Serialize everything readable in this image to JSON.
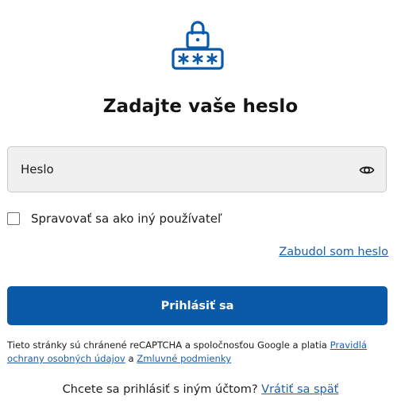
{
  "header": {
    "icon": "password-lock-icon",
    "title": "Zadajte vaše heslo"
  },
  "password_field": {
    "placeholder": "Heslo",
    "value": "",
    "toggle_icon": "eye-icon"
  },
  "impersonate": {
    "label": "Spravovať sa ako iný používateľ",
    "checked": false
  },
  "forgot_password": {
    "label": "Zabudol som heslo"
  },
  "login_button": {
    "label": "Prihlásiť sa"
  },
  "recaptcha": {
    "text_before": "Tieto stránky sú chránené reCAPTCHA a spoločnosťou Google a platia",
    "privacy_link": "Pravidlá ochrany osobných údajov",
    "conjunction": "a",
    "terms_link": "Zmluvné podmienky"
  },
  "switch_account": {
    "question": "Chcete sa prihlásiť s iným účtom?",
    "link": "Vrátiť sa späť"
  },
  "colors": {
    "primary": "#0a5aa8",
    "link": "#1e5fa8",
    "field_background": "#f0f0f0"
  }
}
